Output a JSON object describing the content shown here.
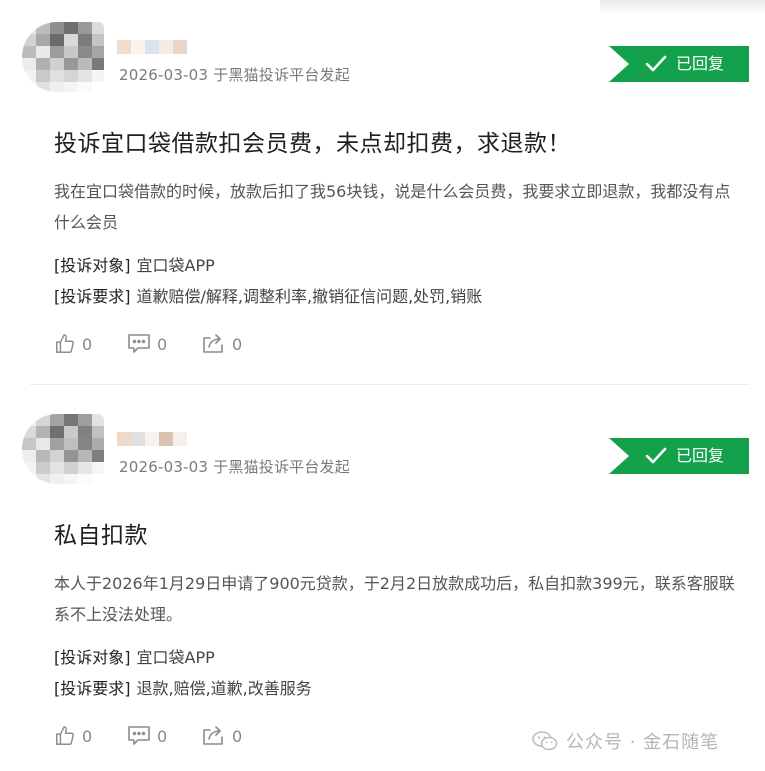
{
  "complaints": [
    {
      "date": "2026-03-03",
      "source": "于黑猫投诉平台发起",
      "status": "已回复",
      "title": "投诉宜口袋借款扣会员费，未点却扣费，求退款！",
      "body": "我在宜口袋借款的时候，放款后扣了我56块钱，说是什么会员费，我要求立即退款，我都没有点什么会员",
      "target_label": "[投诉对象]",
      "target_value": "宜口袋APP",
      "demand_label": "[投诉要求]",
      "demand_value": "道歉赔偿/解释,调整利率,撤销征信问题,处罚,销账",
      "likes": "0",
      "comments": "0",
      "shares": "0"
    },
    {
      "date": "2026-03-03",
      "source": "于黑猫投诉平台发起",
      "status": "已回复",
      "title": "私自扣款",
      "body": "本人于2026年1月29日申请了900元贷款，于2月2日放款成功后，私自扣款399元，联系客服联系不上没法处理。",
      "target_label": "[投诉对象]",
      "target_value": "宜口袋APP",
      "demand_label": "[投诉要求]",
      "demand_value": "退款,赔偿,道歉,改善服务",
      "likes": "0",
      "comments": "0",
      "shares": "0"
    }
  ],
  "watermark": {
    "text": "公众号 · 金石随笔",
    "icon": "wechat-icon"
  },
  "colors": {
    "badge": "#13a14b",
    "meta": "#7a7a7a",
    "title": "#1f1f1f"
  }
}
